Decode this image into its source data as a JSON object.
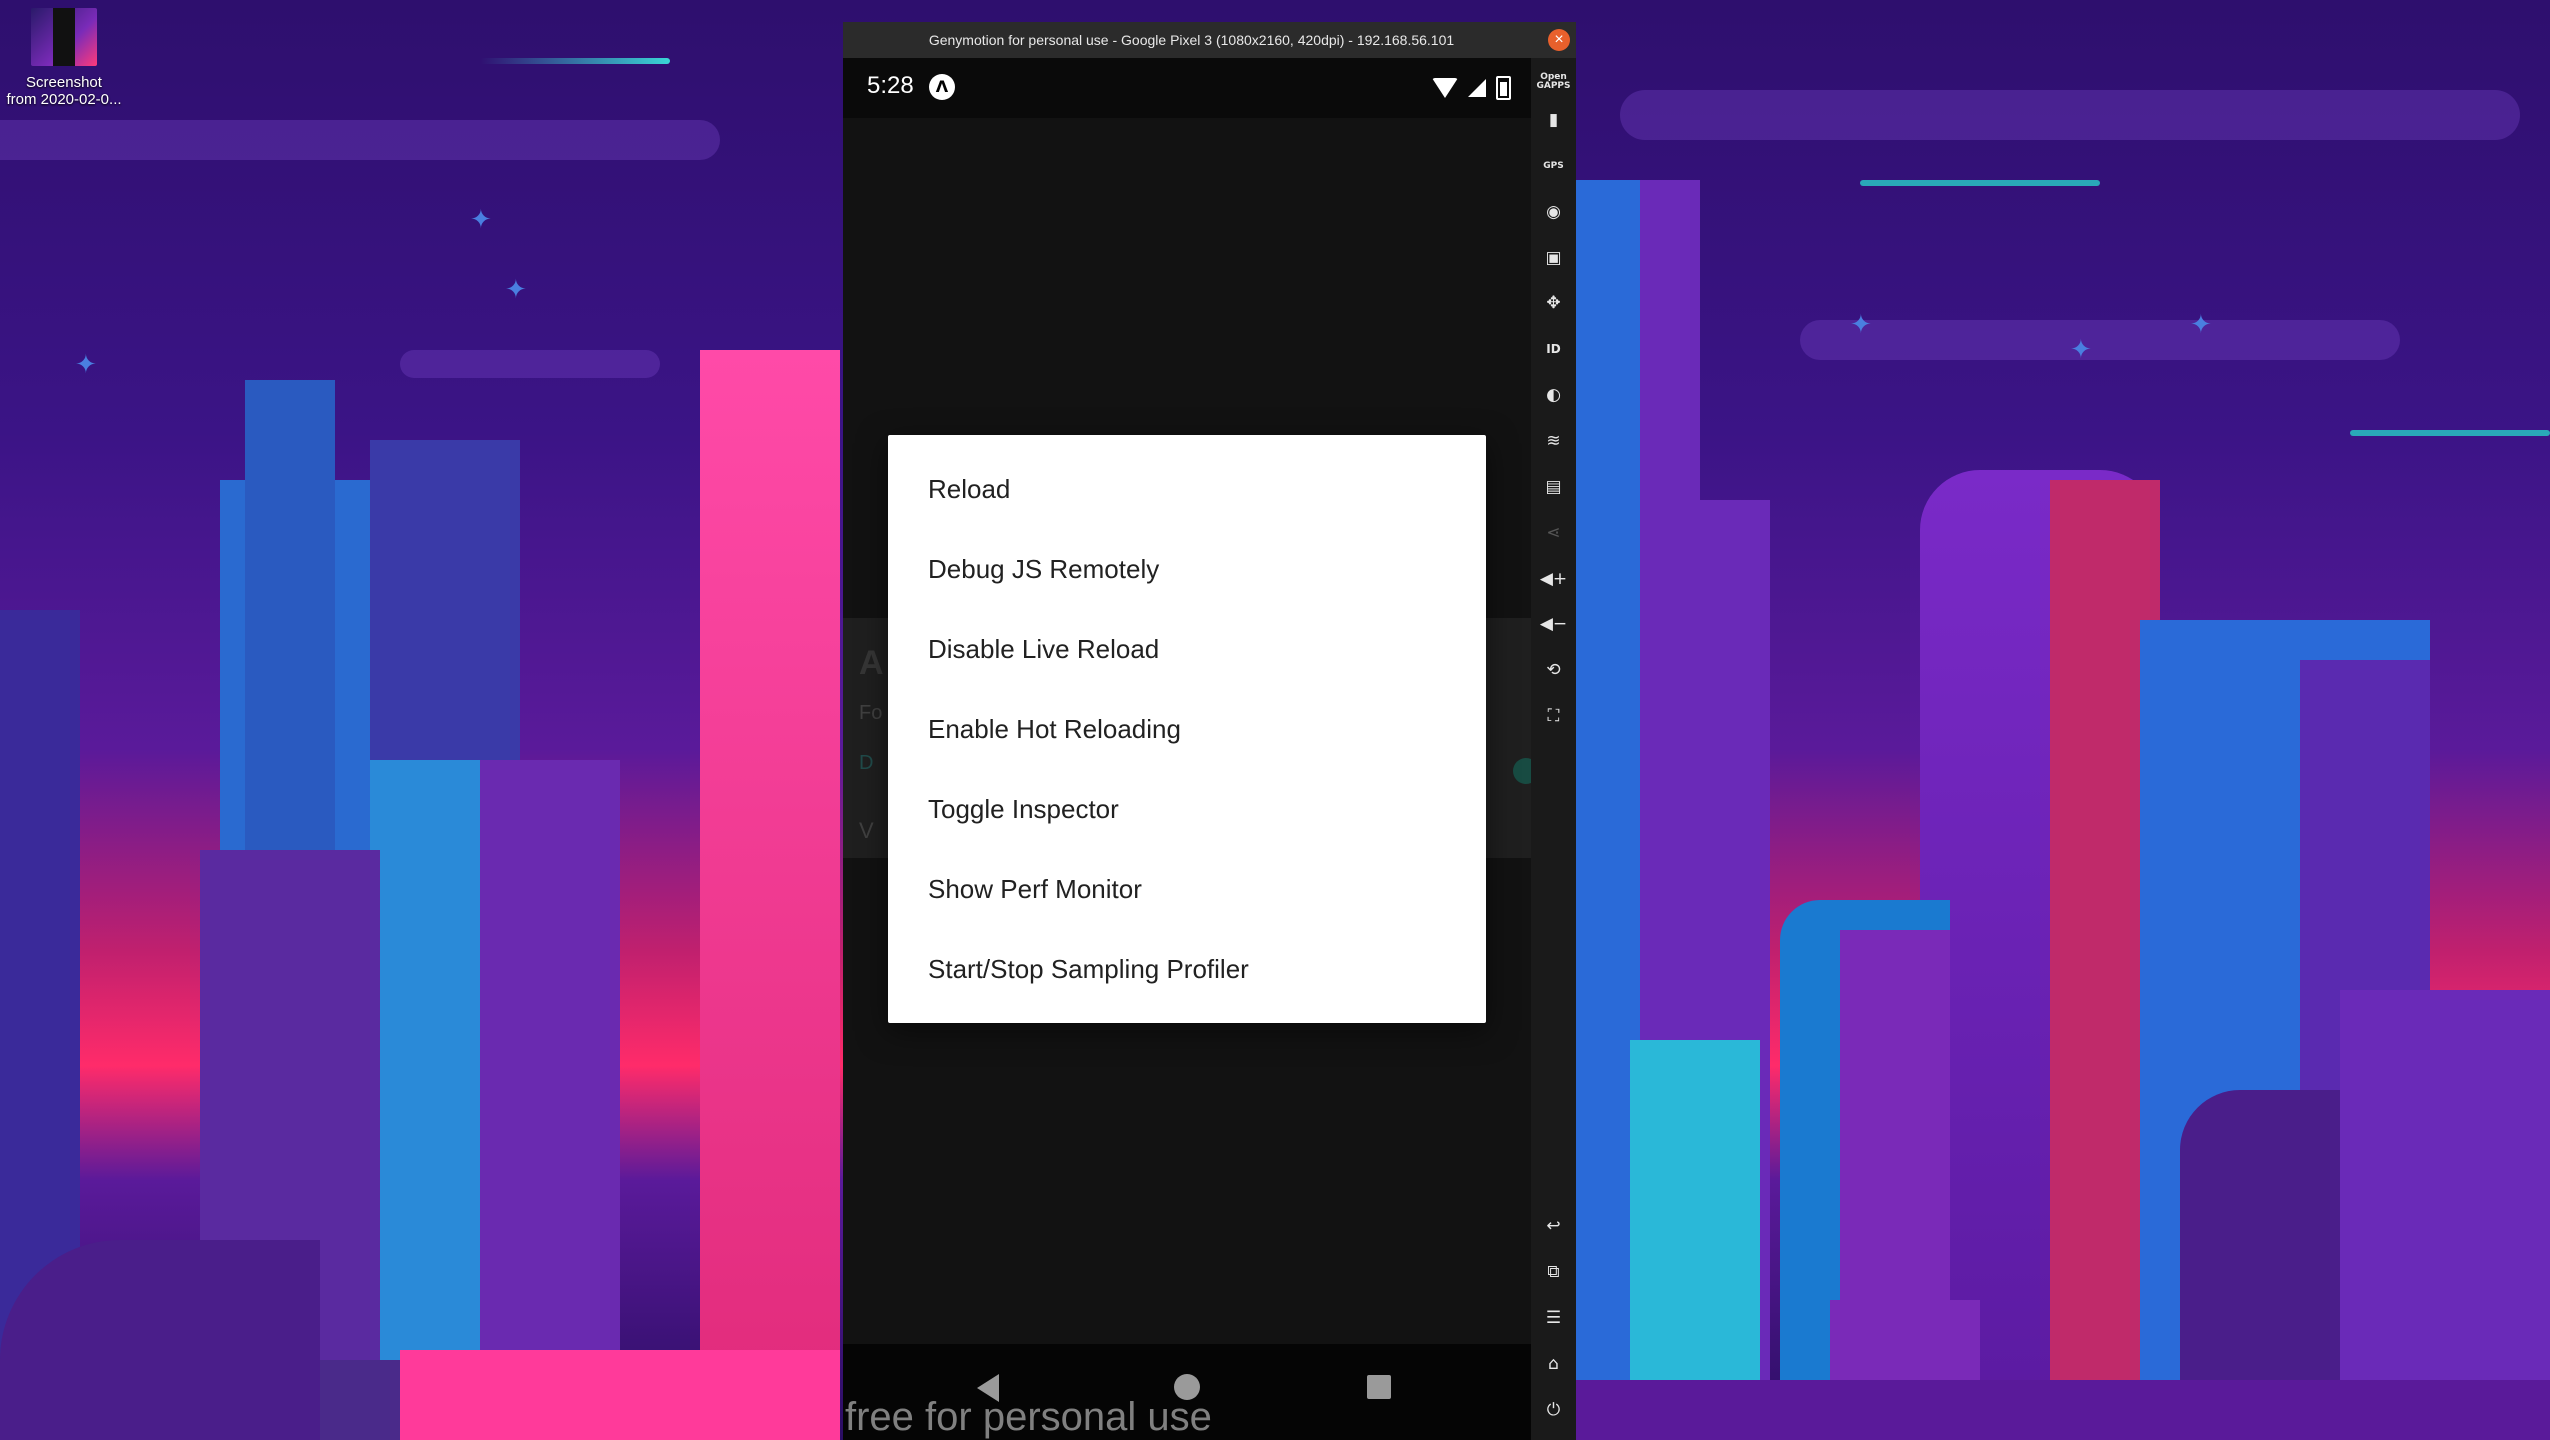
{
  "desktop": {
    "icon_label_line1": "Screenshot",
    "icon_label_line2": "from 2020-02-0..."
  },
  "window": {
    "title": "Genymotion for personal use - Google Pixel 3 (1080x2160, 420dpi) - 192.168.56.101",
    "close_glyph": "×"
  },
  "statusbar": {
    "time": "5:28",
    "app_glyph": "Λ"
  },
  "background_app": {
    "heading": "A",
    "line1": "Fo",
    "line2": "D",
    "line3": "V"
  },
  "dev_menu": {
    "items": [
      {
        "label": "Reload"
      },
      {
        "label": "Debug JS Remotely"
      },
      {
        "label": "Disable Live Reload"
      },
      {
        "label": "Enable Hot Reloading"
      },
      {
        "label": "Toggle Inspector"
      },
      {
        "label": "Show Perf Monitor"
      },
      {
        "label": "Start/Stop Sampling Profiler"
      }
    ]
  },
  "watermark": "free for personal use",
  "toolbar": {
    "open_gapps": "Open GAPPS",
    "gps": "GPS",
    "id": "ID",
    "icons": [
      "open-gapps-icon",
      "battery-icon",
      "gps-icon",
      "webcam-icon",
      "capture-icon",
      "remote-control-icon",
      "identifiers-icon",
      "disk-io-icon",
      "network-icon",
      "sms-icon",
      "share-icon",
      "volume-up-icon",
      "volume-down-icon",
      "rotate-icon",
      "pixel-perfect-icon",
      "back-icon",
      "recent-apps-icon",
      "menu-icon",
      "home-icon",
      "power-icon"
    ]
  }
}
